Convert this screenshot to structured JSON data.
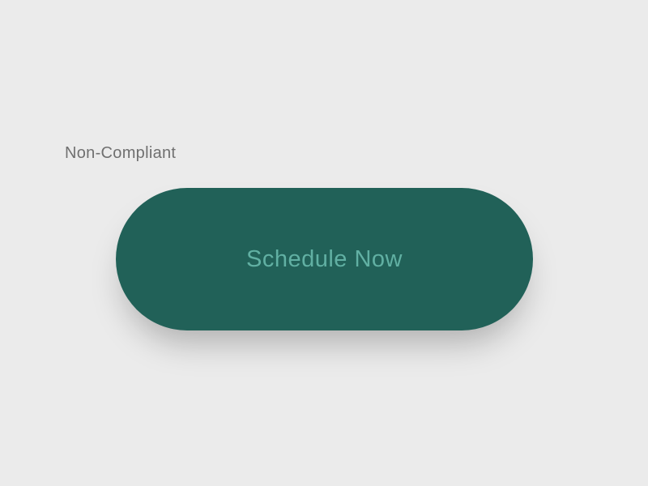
{
  "label": "Non-Compliant",
  "button": {
    "text": "Schedule Now"
  }
}
